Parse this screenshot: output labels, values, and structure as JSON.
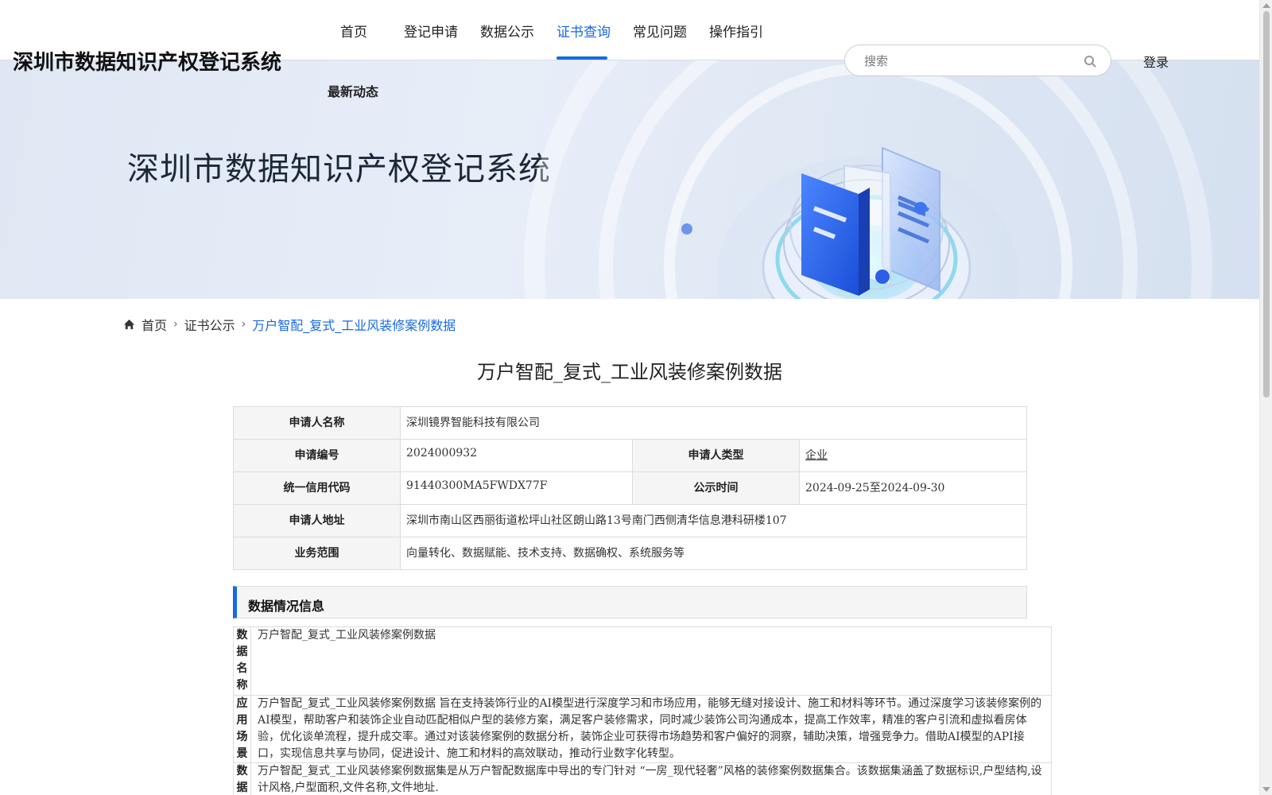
{
  "header": {
    "brand": "深圳市数据知识产权登记系统",
    "nav": [
      "首页",
      "登记申请",
      "数据公示",
      "证书查询",
      "常见问题",
      "操作指引"
    ],
    "nav_second_row": "最新动态",
    "active_nav": "证书查询",
    "search_placeholder": "搜索",
    "login": "登录"
  },
  "banner": {
    "title": "深圳市数据知识产权登记系统"
  },
  "breadcrumb": {
    "home": "首页",
    "level2": "证书公示",
    "current": "万户智配_复式_工业风装修案例数据"
  },
  "page_title": "万户智配_复式_工业风装修案例数据",
  "info": {
    "applicant_name_label": "申请人名称",
    "applicant_name": "深圳镜界智能科技有限公司",
    "app_no_label": "申请编号",
    "app_no": "2024000932",
    "applicant_type_label": "申请人类型",
    "applicant_type": "企业",
    "credit_code_label": "统一信用代码",
    "credit_code": "91440300MA5FWDX77F",
    "publicity_time_label": "公示时间",
    "publicity_time": "2024-09-25至2024-09-30",
    "address_label": "申请人地址",
    "address": "深圳市南山区西丽街道松坪山社区朗山路13号南门西侧清华信息港科研楼107",
    "business_label": "业务范围",
    "business": "向量转化、数据赋能、技术支持、数据确权、系统服务等"
  },
  "data_section": {
    "title": "数据情况信息",
    "rows": [
      {
        "label": "数据名称",
        "value": "万户智配_复式_工业风装修案例数据"
      },
      {
        "label": "应用场景",
        "value": "万户智配_复式_工业风装修案例数据 旨在支持装饰行业的AI模型进行深度学习和市场应用，能够无缝对接设计、施工和材料等环节。通过深度学习该装修案例的AI模型，帮助客户和装饰企业自动匹配相似户型的装修方案，满足客户装修需求，同时减少装饰公司沟通成本，提高工作效率，精准的客户引流和虚拟看房体验，优化谈单流程，提升成交率。通过对该装修案例的数据分析，装饰企业可获得市场趋势和客户偏好的洞察，辅助决策，增强竞争力。借助AI模型的API接口，实现信息共享与协同，促进设计、施工和材料的高效联动，推动行业数字化转型。"
      },
      {
        "label": "数据",
        "value": "万户智配_复式_工业风装修案例数据集是从万户智配数据库中导出的专门针对 “一房_现代轻奢”风格的装修案例数据集合。该数据集涵盖了数据标识,户型结构,设计风格,户型面积,文件名称,文件地址."
      }
    ]
  },
  "colors": {
    "accent": "#1769e0",
    "label_bg": "#f5f5f5",
    "border": "#dcdcdc"
  }
}
